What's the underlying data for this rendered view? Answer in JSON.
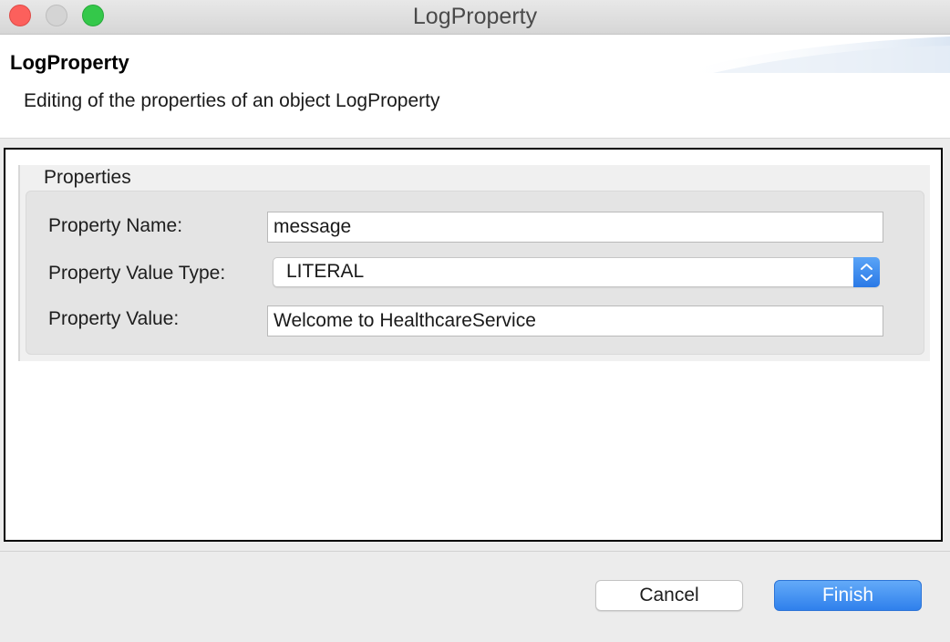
{
  "window": {
    "title": "LogProperty"
  },
  "header": {
    "title": "LogProperty",
    "description": "Editing of the properties of an object LogProperty"
  },
  "properties_group": {
    "legend": "Properties",
    "fields": {
      "name": {
        "label": "Property Name:",
        "value": "message"
      },
      "value_type": {
        "label": "Property Value Type:",
        "selected": "LITERAL"
      },
      "value": {
        "label": "Property Value:",
        "value": "Welcome to HealthcareService"
      }
    }
  },
  "buttons": {
    "cancel": "Cancel",
    "finish": "Finish"
  },
  "icons": {
    "close": "close-circle-icon",
    "minimize": "minimize-circle-icon",
    "maximize": "maximize-circle-icon",
    "stepper": "chevron-up-down-icon"
  },
  "colors": {
    "accent": "#2f80ec",
    "close": "#fc605c",
    "maximize": "#34c84a"
  }
}
